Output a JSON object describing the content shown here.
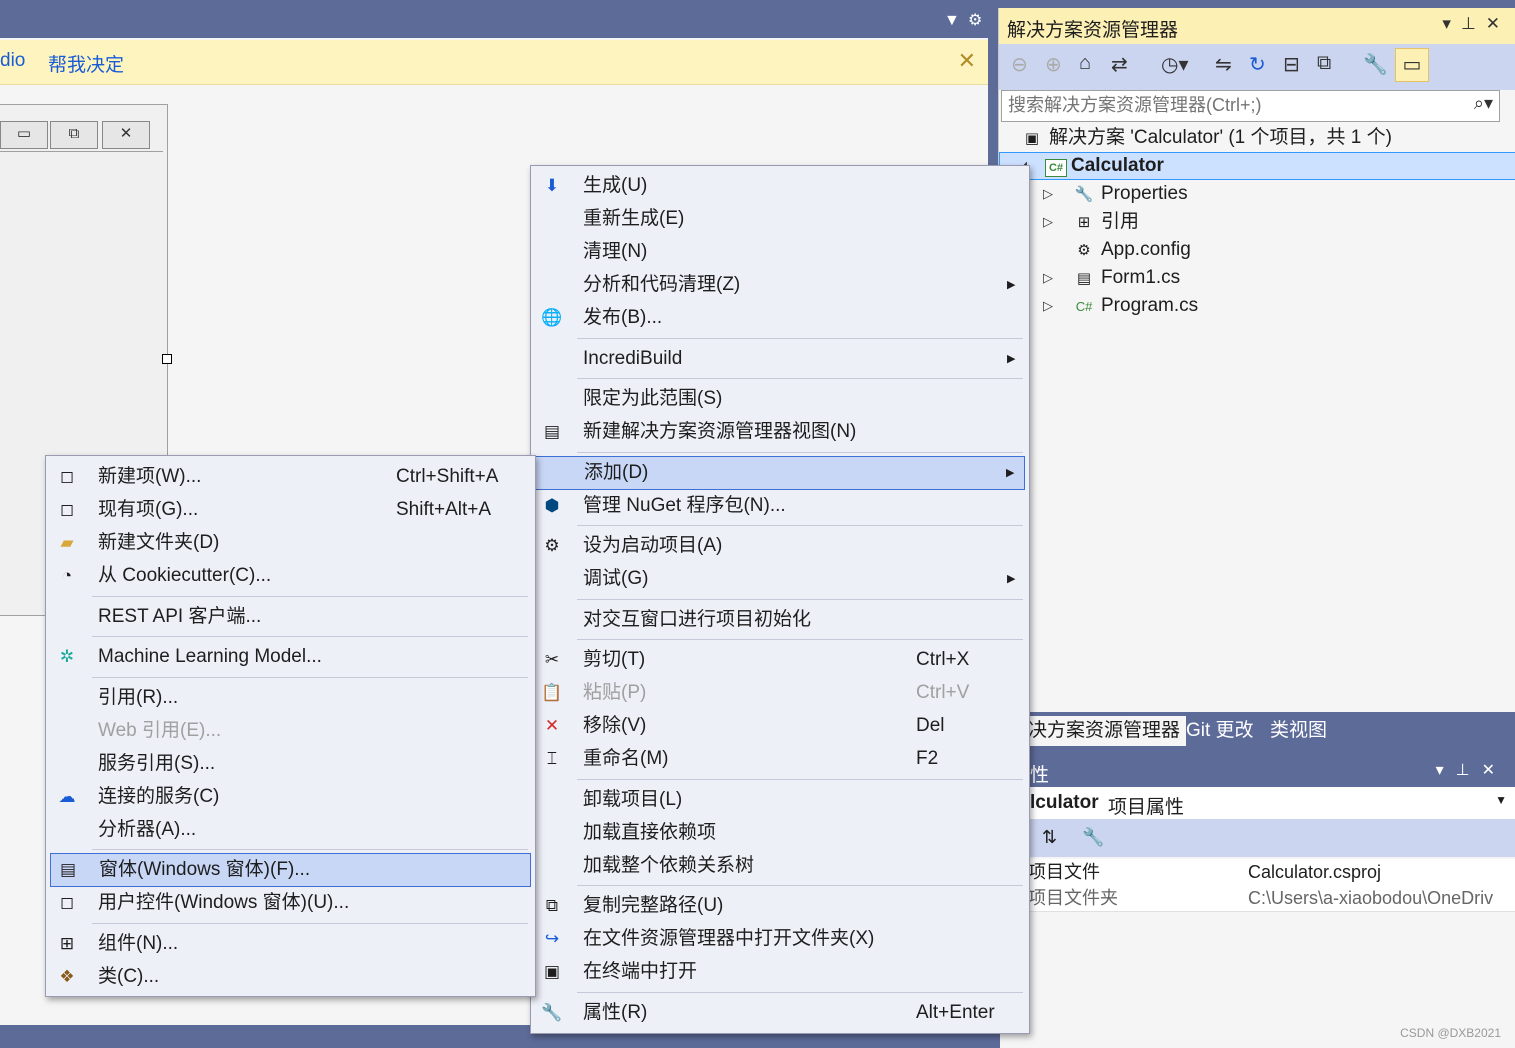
{
  "infobar": {
    "partial_text": "dio",
    "link": "帮我决定"
  },
  "solution_explorer": {
    "title": "解决方案资源管理器",
    "search_placeholder": "搜索解决方案资源管理器(Ctrl+;)",
    "solution_label": "解决方案 'Calculator' (1 个项目，共 1 个)",
    "project": "Calculator",
    "items": [
      {
        "label": "Properties",
        "icon": "wrench-icon"
      },
      {
        "label": "引用",
        "icon": "references-icon"
      },
      {
        "label": "App.config",
        "icon": "config-icon"
      },
      {
        "label": "Form1.cs",
        "icon": "form-icon"
      },
      {
        "label": "Program.cs",
        "icon": "csharp-file-icon"
      }
    ],
    "tabs": [
      "决方案资源管理器",
      "Git 更改",
      "类视图"
    ]
  },
  "properties": {
    "title_partial": "性",
    "object_bold": "lculator",
    "object_type": "项目属性",
    "rows": [
      {
        "key": "项目文件",
        "value": "Calculator.csproj"
      },
      {
        "key": "项目文件夹",
        "value": "C:\\Users\\a-xiaobodou\\OneDriv"
      }
    ]
  },
  "context_menu": {
    "items": [
      {
        "label": "生成(U)",
        "icon": "build-icon"
      },
      {
        "label": "重新生成(E)"
      },
      {
        "label": "清理(N)"
      },
      {
        "label": "分析和代码清理(Z)",
        "submenu": true
      },
      {
        "label": "发布(B)...",
        "icon": "globe-publish-icon"
      },
      {
        "label": "IncrediBuild",
        "submenu": true
      },
      {
        "label": "限定为此范围(S)"
      },
      {
        "label": "新建解决方案资源管理器视图(N)",
        "icon": "new-view-icon"
      },
      {
        "label": "添加(D)",
        "submenu": true
      },
      {
        "label": "管理 NuGet 程序包(N)...",
        "icon": "nuget-icon"
      },
      {
        "label": "设为启动项目(A)",
        "icon": "gear-icon"
      },
      {
        "label": "调试(G)",
        "submenu": true
      },
      {
        "label": "对交互窗口进行项目初始化"
      },
      {
        "label": "剪切(T)",
        "shortcut": "Ctrl+X",
        "icon": "scissors-icon"
      },
      {
        "label": "粘贴(P)",
        "shortcut": "Ctrl+V",
        "icon": "paste-icon",
        "disabled": true
      },
      {
        "label": "移除(V)",
        "shortcut": "Del",
        "icon": "remove-icon"
      },
      {
        "label": "重命名(M)",
        "shortcut": "F2",
        "icon": "rename-icon"
      },
      {
        "label": "卸载项目(L)"
      },
      {
        "label": "加载直接依赖项"
      },
      {
        "label": "加载整个依赖关系树"
      },
      {
        "label": "复制完整路径(U)",
        "icon": "copy-icon"
      },
      {
        "label": "在文件资源管理器中打开文件夹(X)",
        "icon": "open-folder-icon"
      },
      {
        "label": "在终端中打开",
        "icon": "terminal-icon"
      },
      {
        "label": "属性(R)",
        "shortcut": "Alt+Enter",
        "icon": "wrench-icon"
      }
    ]
  },
  "add_submenu": {
    "items": [
      {
        "label": "新建项(W)...",
        "shortcut": "Ctrl+Shift+A",
        "icon": "new-item-icon"
      },
      {
        "label": "现有项(G)...",
        "shortcut": "Shift+Alt+A",
        "icon": "existing-item-icon"
      },
      {
        "label": "新建文件夹(D)",
        "icon": "new-folder-icon"
      },
      {
        "label": "从 Cookiecutter(C)...",
        "icon": "cookiecutter-icon"
      },
      {
        "label": "REST API 客户端..."
      },
      {
        "label": "Machine Learning Model...",
        "icon": "ml-model-icon"
      },
      {
        "label": "引用(R)..."
      },
      {
        "label": "Web 引用(E)...",
        "disabled": true
      },
      {
        "label": "服务引用(S)..."
      },
      {
        "label": "连接的服务(C)",
        "icon": "connected-service-icon"
      },
      {
        "label": "分析器(A)..."
      },
      {
        "label": "窗体(Windows 窗体)(F)...",
        "icon": "windows-form-icon"
      },
      {
        "label": "用户控件(Windows 窗体)(U)...",
        "icon": "user-control-icon"
      },
      {
        "label": "组件(N)...",
        "icon": "component-icon"
      },
      {
        "label": "类(C)...",
        "icon": "class-icon"
      }
    ]
  },
  "watermark": "CSDN @DXB2021"
}
